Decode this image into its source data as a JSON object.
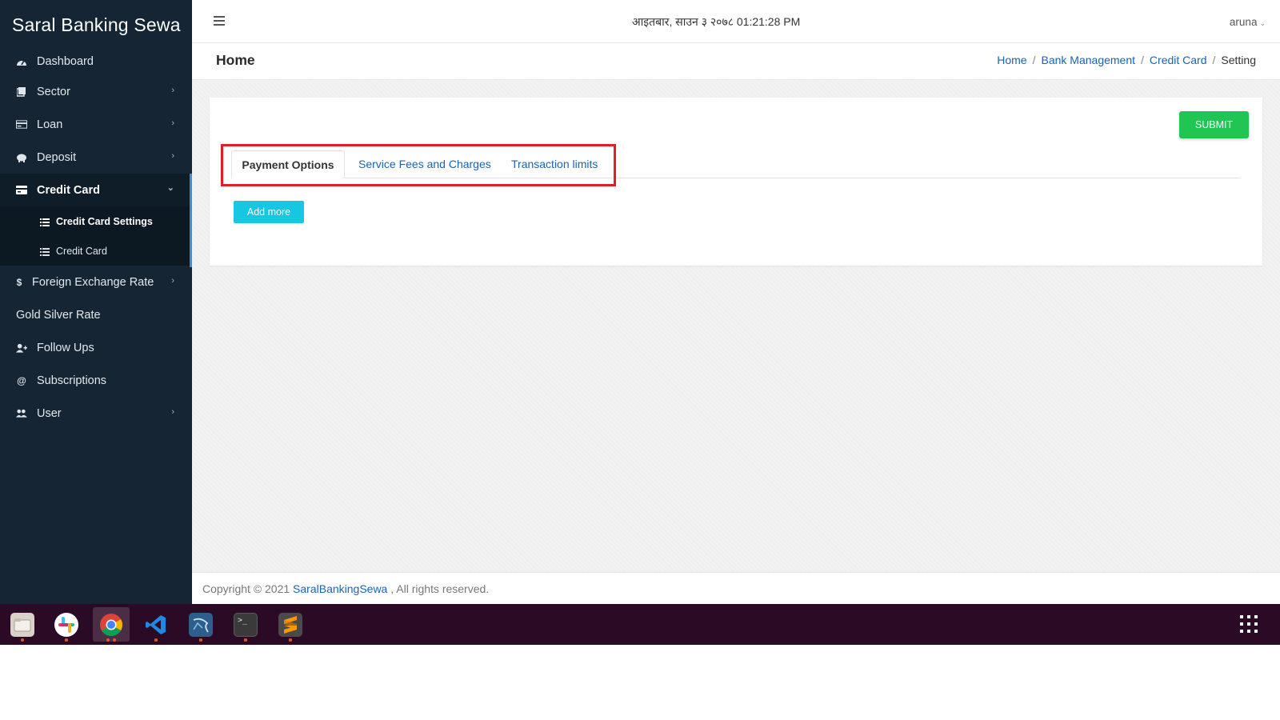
{
  "sidebar": {
    "brand": "Saral Banking Sewa",
    "items": [
      {
        "label": "Dashboard",
        "icon": "dashboard-icon"
      },
      {
        "label": "Sector",
        "icon": "book-icon"
      },
      {
        "label": "Loan",
        "icon": "money-icon"
      },
      {
        "label": "Deposit",
        "icon": "piggy-bank-icon"
      },
      {
        "label": "Credit Card",
        "icon": "credit-card-icon"
      },
      {
        "label": "Foreign Exchange Rate",
        "icon": "dollar-icon"
      },
      {
        "label": "Gold Silver Rate"
      },
      {
        "label": "Follow Ups",
        "icon": "user-plus-icon"
      },
      {
        "label": "Subscriptions",
        "icon": "at-icon"
      },
      {
        "label": "User",
        "icon": "users-icon"
      }
    ],
    "credit_card_sub": [
      {
        "label": "Credit Card Settings",
        "icon": "list-icon"
      },
      {
        "label": "Credit Card",
        "icon": "list-icon"
      }
    ]
  },
  "topbar": {
    "datetime": "आइतबार, साउन ३ २०७८  01:21:28 PM",
    "user": "aruna"
  },
  "page": {
    "title": "Home",
    "breadcrumb": [
      "Home",
      "Bank Management",
      "Credit Card",
      "Setting"
    ]
  },
  "card": {
    "submit_label": "SUBMIT",
    "tabs": [
      "Payment Options",
      "Service Fees and Charges",
      "Transaction limits"
    ],
    "add_more_label": "Add more"
  },
  "footer": {
    "prefix": "Copyright © 2021",
    "link": "SaralBankingSewa",
    "suffix": ", All rights reserved."
  },
  "taskbar": {
    "apps": [
      "files-icon",
      "slack-icon",
      "chrome-icon",
      "vscode-icon",
      "mysql-workbench-icon",
      "terminal-icon",
      "sublime-text-icon"
    ],
    "running_app": "chrome-icon",
    "grid_icon": "show-applications-icon"
  },
  "colors": {
    "sidebar_bg": "#152533",
    "submit": "#21c552",
    "add_more": "#17c6e0",
    "link": "#1a62b8",
    "highlight": "#e01e2a",
    "taskbar": "#2a0a24"
  }
}
